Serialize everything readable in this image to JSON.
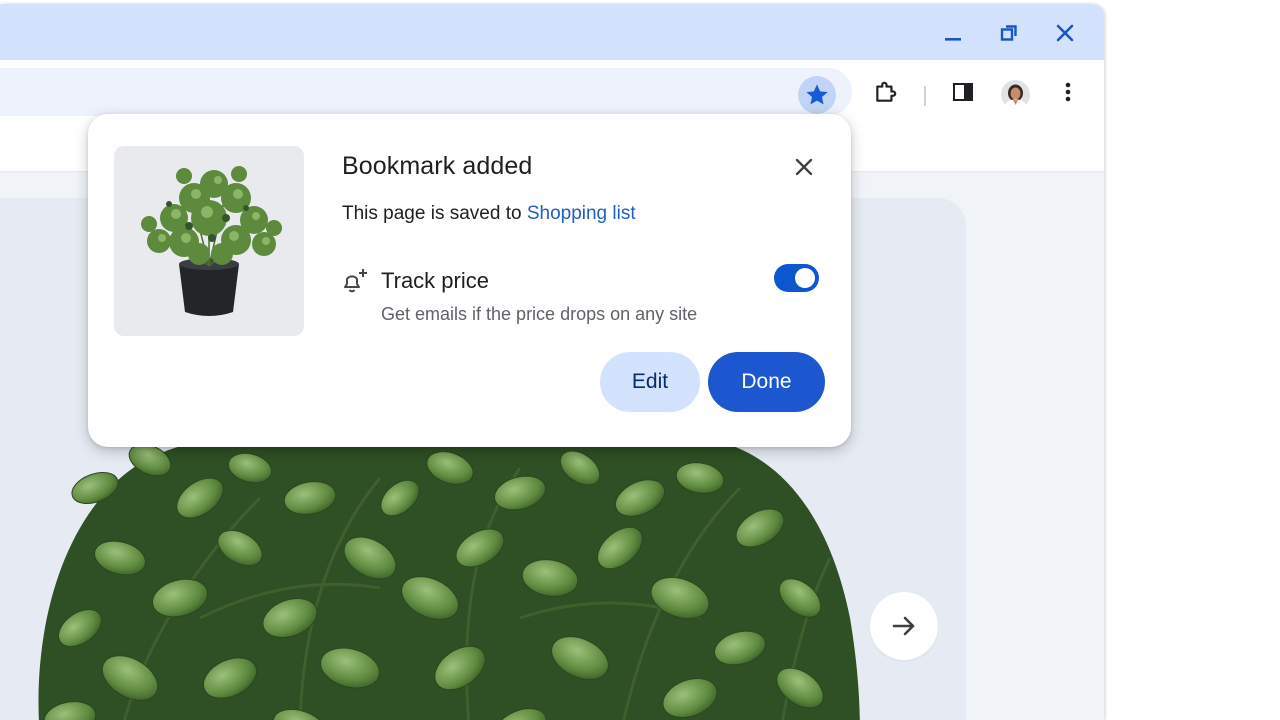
{
  "window_controls": {
    "minimize_icon": "minimize-icon",
    "restore_icon": "restore-icon",
    "close_icon": "close-icon"
  },
  "toolbar": {
    "bookmark_icon": "star-filled-icon",
    "extensions_icon": "puzzle-icon",
    "side_panel_icon": "side-panel-icon",
    "profile_icon": "avatar",
    "menu_icon": "kebab-menu-icon"
  },
  "bookmark_dialog": {
    "title": "Bookmark added",
    "saved_prefix": "This page is saved to ",
    "folder_link": "Shopping list",
    "track_price": {
      "title": "Track price",
      "description": "Get emails if the price drops on any site",
      "enabled": true
    },
    "edit_label": "Edit",
    "done_label": "Done"
  },
  "colors": {
    "titlebar": "#d3e3fd",
    "accent": "#0b57d0",
    "done_button": "#1c57cf",
    "edit_button": "#d3e3fd",
    "link": "#1f5fbf"
  }
}
